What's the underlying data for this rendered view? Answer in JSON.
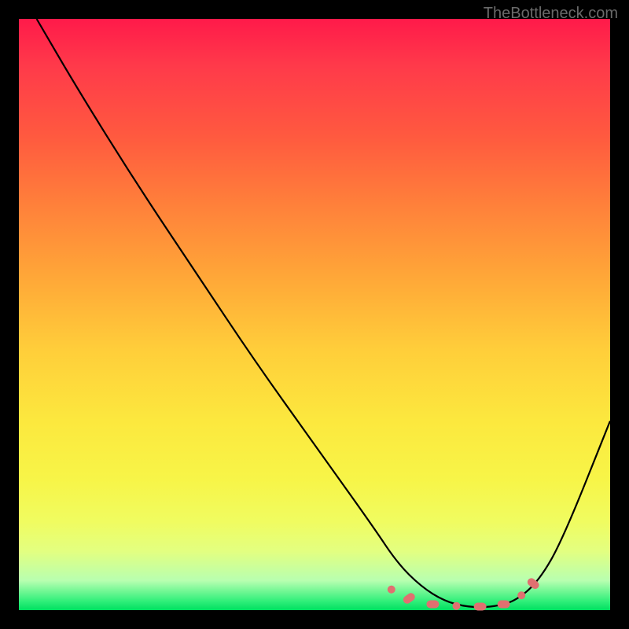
{
  "watermark": "TheBottleneck.com",
  "chart_data": {
    "type": "line",
    "title": "",
    "xlabel": "",
    "ylabel": "",
    "xlim": [
      0,
      100
    ],
    "ylim": [
      0,
      100
    ],
    "grid": false,
    "legend": false,
    "series": [
      {
        "name": "bottleneck-curve",
        "color": "#000000",
        "x": [
          3,
          10,
          20,
          30,
          40,
          50,
          60,
          64,
          68,
          72,
          76,
          80,
          84,
          88,
          92,
          100
        ],
        "y": [
          100,
          88,
          72,
          57,
          42,
          28,
          14,
          8,
          4,
          1.5,
          0.5,
          0.5,
          1.5,
          5,
          12,
          32
        ]
      },
      {
        "name": "optimal-markers",
        "color": "#e07070",
        "type": "scatter",
        "x": [
          63,
          66,
          70,
          74,
          78,
          82,
          85,
          87
        ],
        "y": [
          3.5,
          2,
          1,
          0.7,
          0.6,
          1,
          2.5,
          4.5
        ]
      }
    ]
  }
}
